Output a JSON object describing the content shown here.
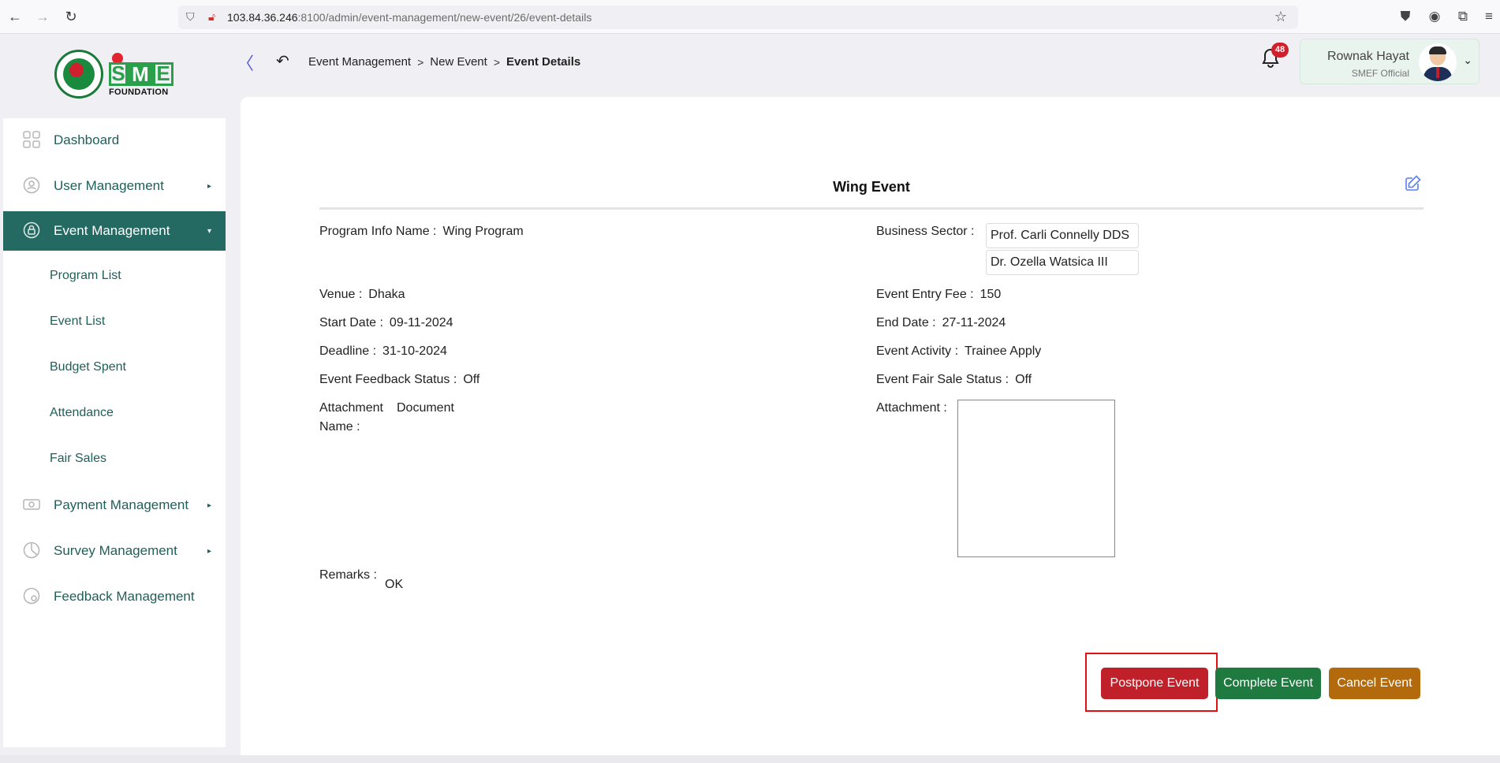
{
  "browser": {
    "url_host": "103.84.36.246",
    "url_path": ":8100/admin/event-management/new-event/26/event-details"
  },
  "logo": {
    "text": "FOUNDATION"
  },
  "header": {
    "collapse_glyph": "〈",
    "breadcrumb": [
      "Event Management",
      "New Event",
      "Event Details"
    ],
    "notification_count": "48",
    "user_name": "Rownak Hayat",
    "user_role": "SMEF Official"
  },
  "sidebar": {
    "items": [
      {
        "label": "Dashboard",
        "icon": "grid-icon"
      },
      {
        "label": "User Management",
        "icon": "shield-user-icon"
      },
      {
        "label": "Event Management",
        "icon": "lock-circle-icon"
      },
      {
        "label": "Payment Management",
        "icon": "money-icon"
      },
      {
        "label": "Survey Management",
        "icon": "pie-chart-icon"
      },
      {
        "label": "Feedback Management",
        "icon": "feedback-icon"
      }
    ],
    "sub_items": [
      "Program List",
      "Event List",
      "Budget Spent",
      "Attendance",
      "Fair Sales"
    ]
  },
  "event": {
    "title": "Wing Event",
    "program_info_name_label": "Program Info Name :",
    "program_info_name": "Wing Program",
    "business_sector_label": "Business Sector :",
    "business_sectors": [
      "Prof. Carli Connelly DDS",
      "Dr. Ozella Watsica III"
    ],
    "venue_label": "Venue :",
    "venue": "Dhaka",
    "entry_fee_label": "Event Entry Fee :",
    "entry_fee": "150",
    "start_date_label": "Start Date :",
    "start_date": "09-11-2024",
    "end_date_label": "End Date :",
    "end_date": "27-11-2024",
    "deadline_label": "Deadline :",
    "deadline": "31-10-2024",
    "activity_label": "Event Activity :",
    "activity": "Trainee Apply",
    "feedback_status_label": "Event Feedback Status :",
    "feedback_status": "Off",
    "fair_sale_status_label": "Event Fair Sale Status :",
    "fair_sale_status": "Off",
    "attachment_name_label_1": "Attachment",
    "attachment_name_label_2": "Name :",
    "attachment_name": "Document",
    "attachment_label": "Attachment :",
    "remarks_label": "Remarks :",
    "remarks": "OK"
  },
  "actions": {
    "postpone": "Postpone Event",
    "complete": "Complete Event",
    "cancel": "Cancel Event"
  },
  "colors": {
    "sidebar_active": "#256a62",
    "postpone": "#c0202a",
    "complete": "#1f7a3f",
    "cancel": "#b36a0c"
  }
}
